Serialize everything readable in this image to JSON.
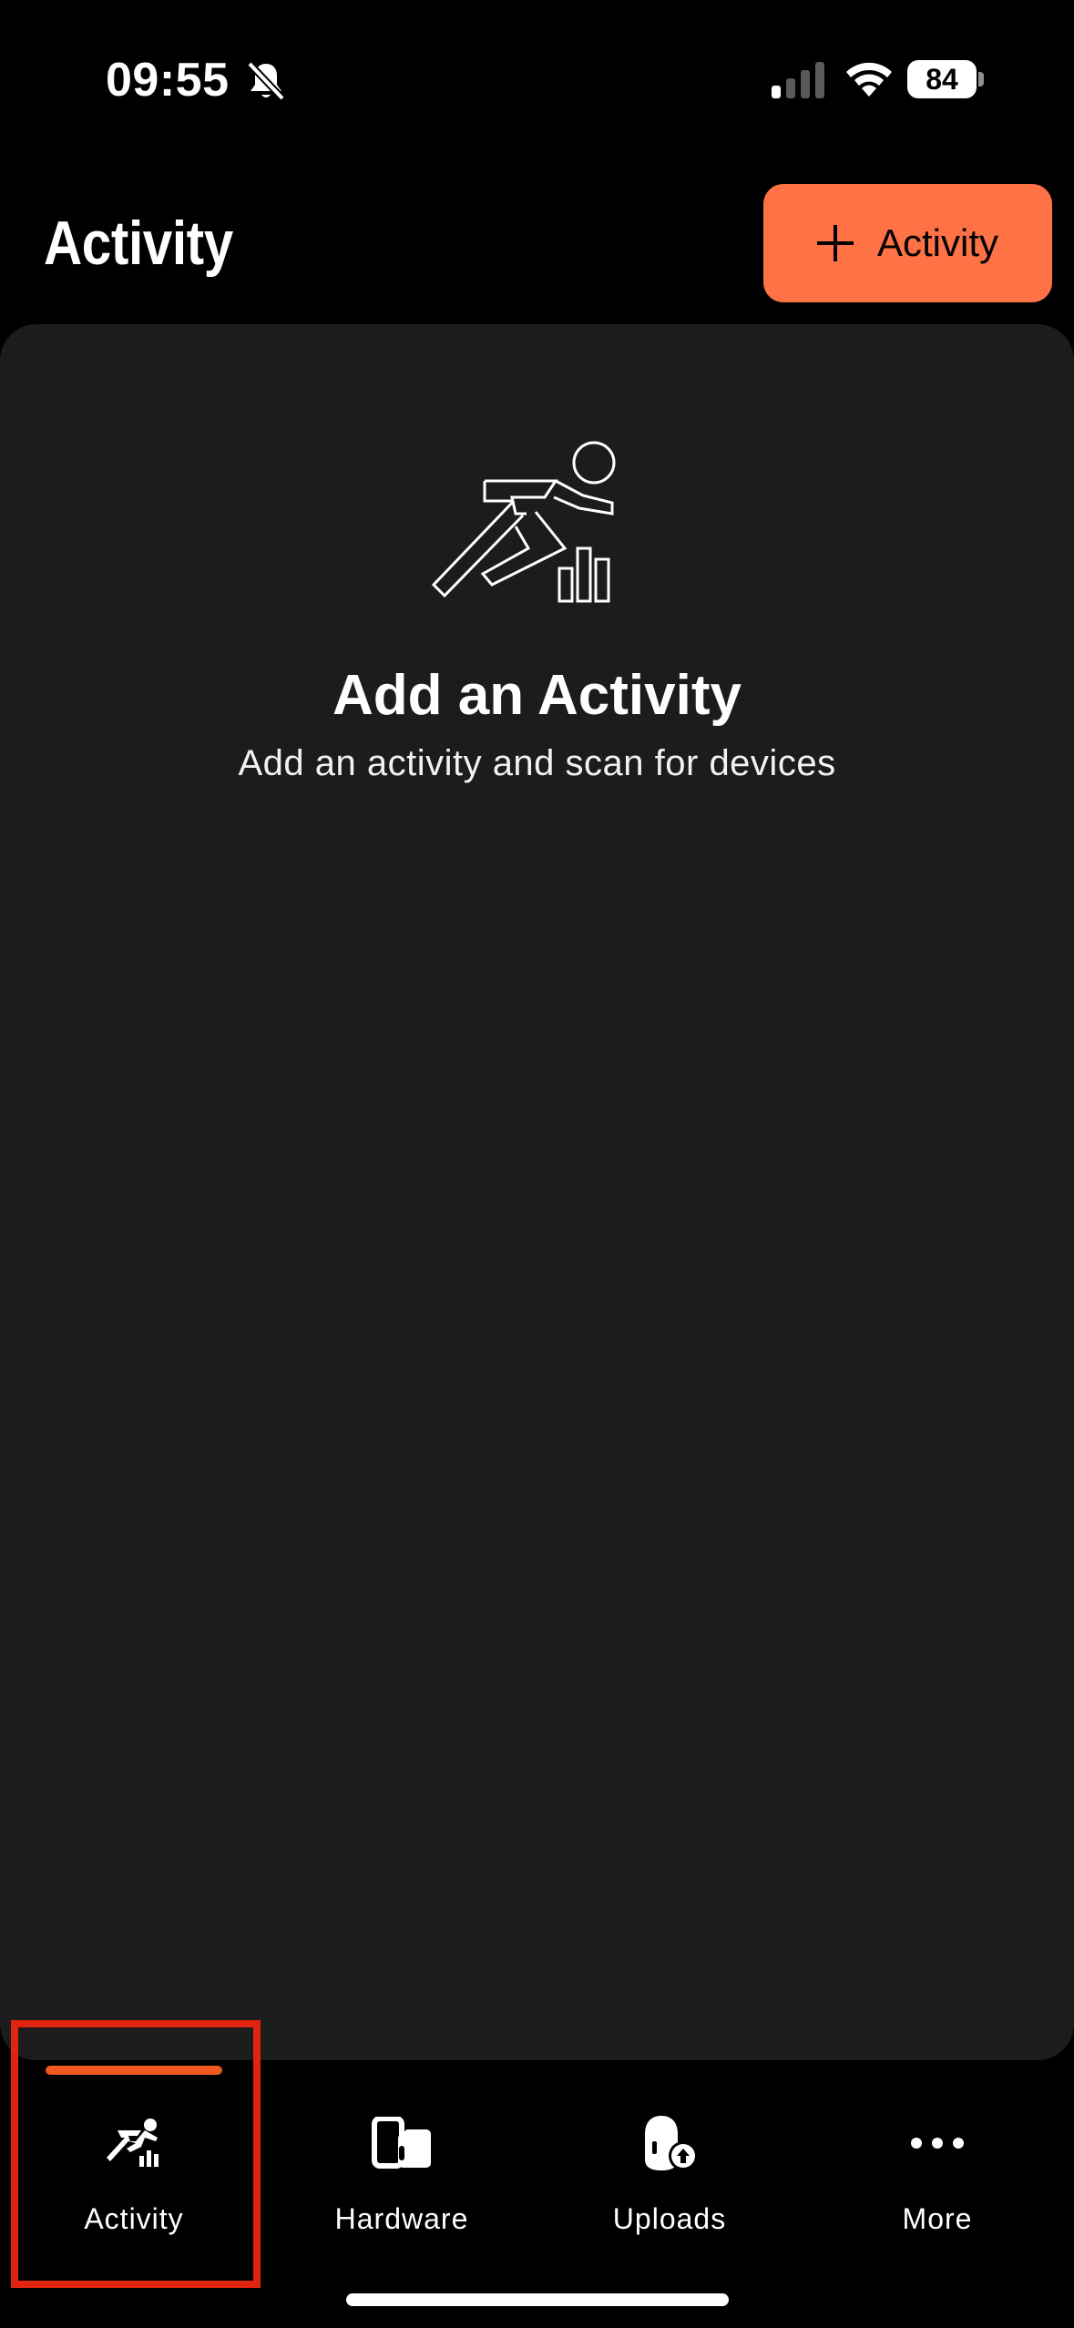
{
  "status_bar": {
    "time": "09:55",
    "battery_level": "84",
    "icons": [
      "bell-slash-icon",
      "cellular-signal-icon",
      "wifi-icon",
      "battery-icon"
    ]
  },
  "header": {
    "title": "Activity",
    "add_button_label": "Activity",
    "add_button_color": "#ff7245"
  },
  "empty_state": {
    "icon": "runner-chart-icon",
    "title": "Add an Activity",
    "subtitle": "Add an activity and scan for devices"
  },
  "tab_bar": {
    "active_color": "#f05a1e",
    "tabs": [
      {
        "label": "Activity",
        "icon": "runner-icon",
        "active": true
      },
      {
        "label": "Hardware",
        "icon": "devices-icon",
        "active": false
      },
      {
        "label": "Uploads",
        "icon": "upload-icon",
        "active": false
      },
      {
        "label": "More",
        "icon": "more-icon",
        "active": false
      }
    ]
  }
}
